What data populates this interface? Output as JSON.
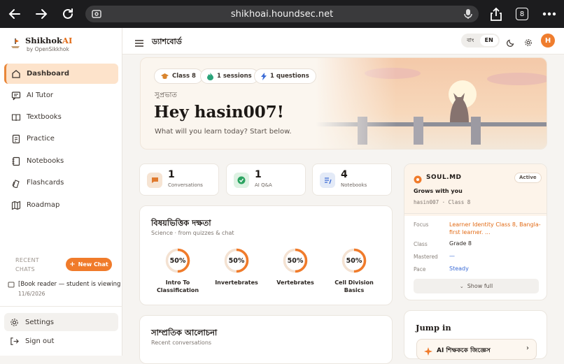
{
  "browser": {
    "url": "shikhoai.houndsec.net",
    "tab_count": "8"
  },
  "brand": {
    "name_main": "Shikhok",
    "name_accent": "AI",
    "by": "by OpenSikkhok"
  },
  "sidebar": {
    "items": [
      {
        "label": "Dashboard",
        "icon": "home-icon"
      },
      {
        "label": "AI Tutor",
        "icon": "chat-icon"
      },
      {
        "label": "Textbooks",
        "icon": "book-icon"
      },
      {
        "label": "Practice",
        "icon": "practice-icon"
      },
      {
        "label": "Notebooks",
        "icon": "notebook-icon"
      },
      {
        "label": "Flashcards",
        "icon": "flashcard-icon"
      },
      {
        "label": "Roadmap",
        "icon": "roadmap-icon"
      }
    ],
    "recent_label_1": "RECENT",
    "recent_label_2": "CHATS",
    "new_chat": "New Chat",
    "chat": {
      "title": "[Book reader — student is viewing",
      "date": "11/6/2026"
    },
    "settings": "Settings",
    "signout": "Sign out"
  },
  "topbar": {
    "title": "ড্যাশবোর্ড",
    "lang_bn": "বাং",
    "lang_en": "EN",
    "avatar": "H"
  },
  "hero": {
    "pills": [
      "Class 8",
      "1 sessions",
      "1 questions"
    ],
    "salutation": "সুপ্রভাত",
    "greeting": "Hey hasin007!",
    "subtitle": "What will you learn today? Start below."
  },
  "stats": [
    {
      "value": "1",
      "label": "Conversations",
      "color": "#f6e4d3"
    },
    {
      "value": "1",
      "label": "AI Q&A",
      "color": "#def2e3"
    },
    {
      "value": "4",
      "label": "Notebooks",
      "color": "#e3eaf7"
    }
  ],
  "mastery": {
    "title": "বিষয়ভিত্তিক দক্ষতা",
    "subtitle": "Science · from quizzes & chat",
    "topics": [
      {
        "label_1": "Intro To",
        "label_2": "Classification",
        "percent": "50%",
        "fraction": 0.5
      },
      {
        "label_1": "Invertebrates",
        "label_2": "",
        "percent": "50%",
        "fraction": 0.5
      },
      {
        "label_1": "Vertebrates",
        "label_2": "",
        "percent": "50%",
        "fraction": 0.5
      },
      {
        "label_1": "Cell Division",
        "label_2": "Basics",
        "percent": "50%",
        "fraction": 0.5
      }
    ]
  },
  "recent": {
    "title": "সাম্প্রতিক আলোচনা",
    "subtitle": "Recent conversations"
  },
  "soul": {
    "title": "SOUL.MD",
    "badge": "Active",
    "grows": "Grows with you",
    "handle": "hasin007 · Class 8",
    "focus_key": "Focus",
    "focus_val_1": "Learner Identity Class 8, Bangla-",
    "focus_val_2": "first learner. ...",
    "class_key": "Class",
    "class_val": "Grade 8",
    "mastered_key": "Mastered",
    "mastered_val": "—",
    "pace_key": "Pace",
    "pace_val": "Steady",
    "show_full": "Show full"
  },
  "jump": {
    "title": "Jump in",
    "button": "AI শিক্ষককে জিজ্ঞেস"
  },
  "colors": {
    "accent": "#f07b2b",
    "ring": "#f07b2b",
    "link": "#e26b16"
  }
}
